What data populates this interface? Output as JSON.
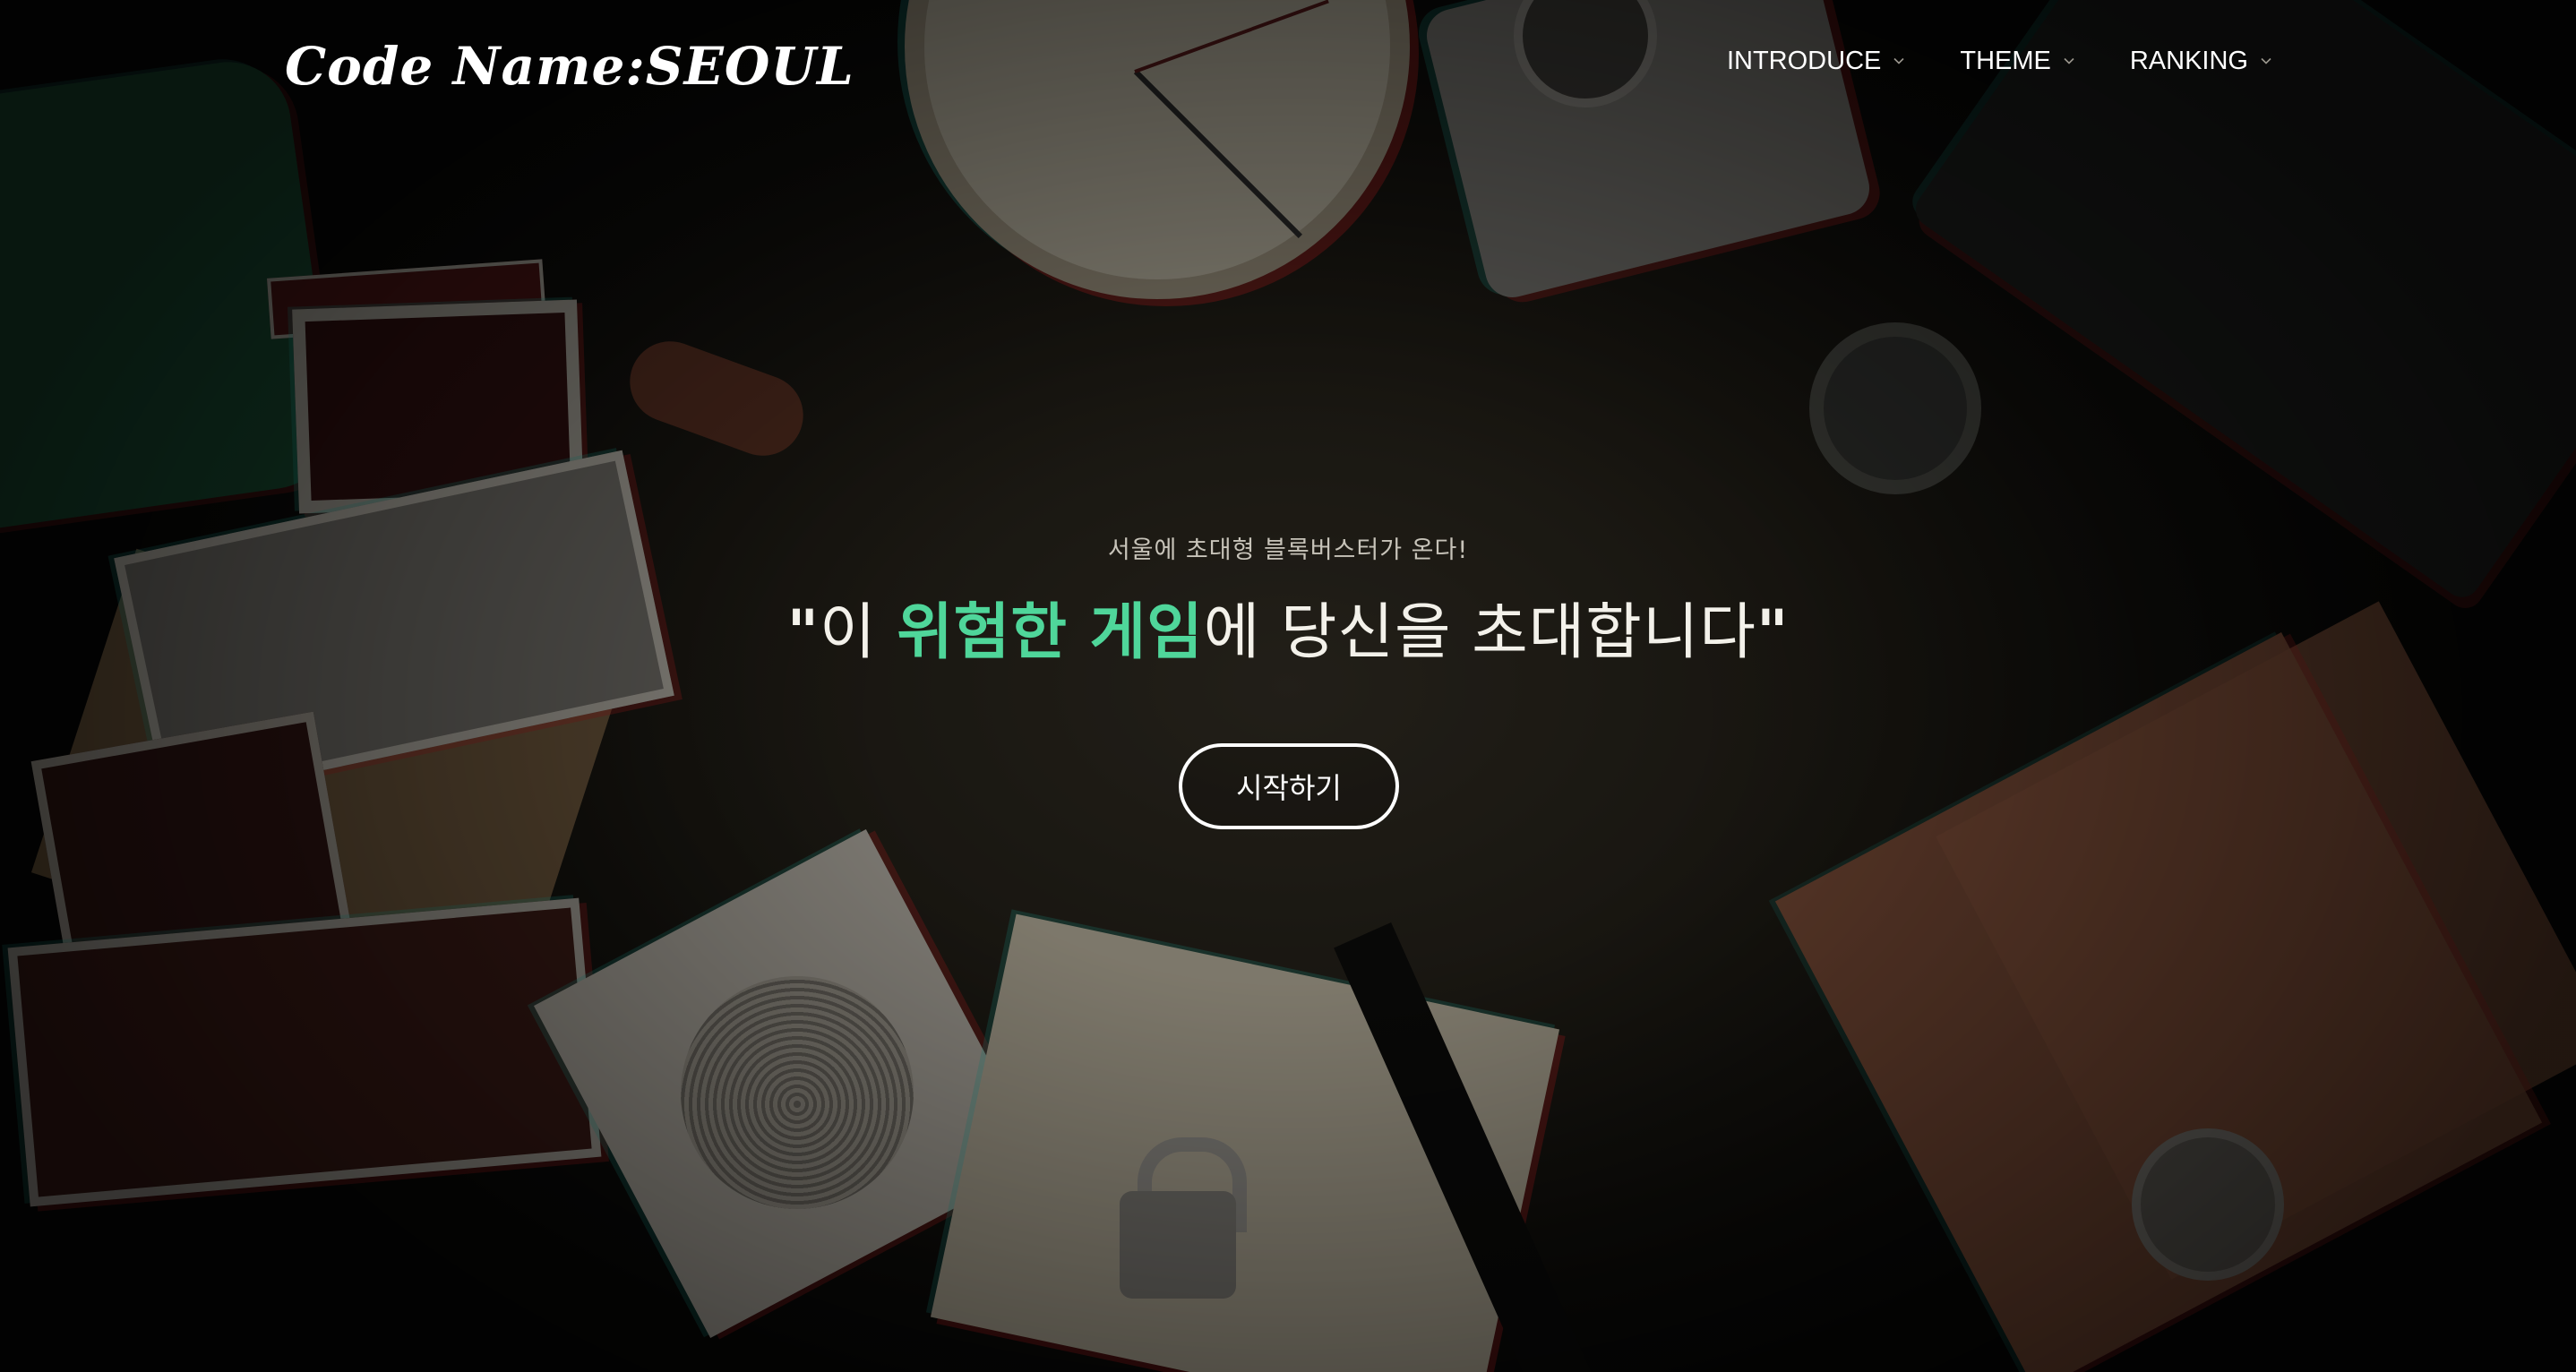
{
  "header": {
    "logo_text": "Code Name:SEOUL",
    "nav": [
      {
        "label": "INTRODUCE",
        "icon": "chevron-down-icon"
      },
      {
        "label": "THEME",
        "icon": "chevron-down-icon"
      },
      {
        "label": "RANKING",
        "icon": "chevron-down-icon"
      }
    ]
  },
  "hero": {
    "subtitle": "서울에 초대형 블록버스터가 온다!",
    "headline": {
      "open_quote": "\"",
      "prefix": "이 ",
      "accent": "위험한 게임",
      "suffix": "에 당신을 초대합니다",
      "close_quote": "\""
    },
    "cta_label": "시작하기"
  },
  "colors": {
    "accent": "#4fd69a",
    "text": "#ffffff",
    "background": "#1a1812"
  }
}
